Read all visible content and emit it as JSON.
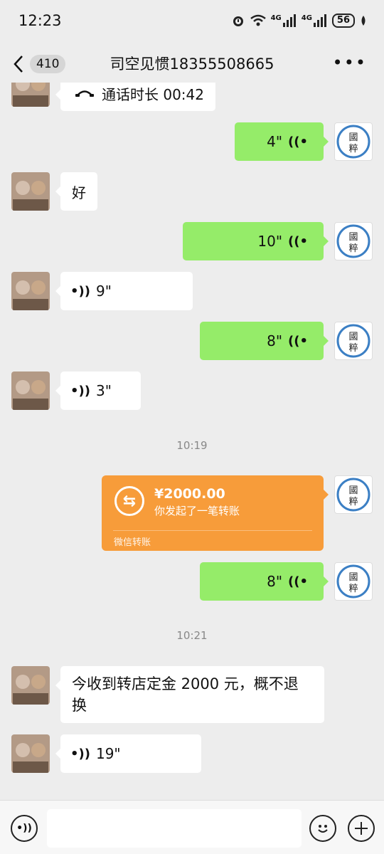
{
  "status_bar": {
    "time": "12:23",
    "net1": "4G",
    "net2": "4G",
    "battery": "56"
  },
  "header": {
    "back_count": "410",
    "title": "司空见惯18355508665",
    "more": "•••"
  },
  "messages": [
    {
      "type": "call",
      "side": "other",
      "text": "通话时长 00:42"
    },
    {
      "type": "voice",
      "side": "me",
      "duration": "4\""
    },
    {
      "type": "text",
      "side": "other",
      "text": "好"
    },
    {
      "type": "voice",
      "side": "me",
      "duration": "10\""
    },
    {
      "type": "voice",
      "side": "other",
      "duration": "9\""
    },
    {
      "type": "voice",
      "side": "me",
      "duration": "8\""
    },
    {
      "type": "voice",
      "side": "other",
      "duration": "3\""
    },
    {
      "type": "time",
      "text": "10:19"
    },
    {
      "type": "transfer",
      "side": "me",
      "amount": "¥2000.00",
      "desc": "你发起了一笔转账",
      "footer": "微信转账"
    },
    {
      "type": "voice",
      "side": "me",
      "duration": "8\""
    },
    {
      "type": "time",
      "text": "10:21"
    },
    {
      "type": "text",
      "side": "other",
      "line1": "今收到转店定金 2000 元，概不退",
      "line2": "换"
    },
    {
      "type": "voice",
      "side": "other",
      "duration": "19\""
    }
  ],
  "colors": {
    "sent_bubble": "#95ec69",
    "transfer_bubble": "#f79c3a",
    "background": "#ededed"
  }
}
